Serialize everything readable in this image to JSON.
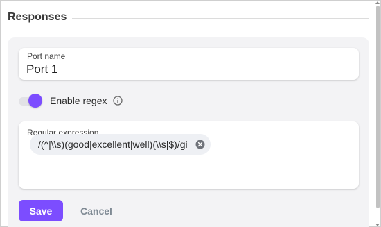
{
  "section": {
    "title": "Responses"
  },
  "port_name": {
    "label": "Port name",
    "value": "Port 1"
  },
  "regex_toggle": {
    "label": "Enable regex",
    "enabled": true,
    "info_icon": "info-icon"
  },
  "regular_expression": {
    "label": "Regular expression",
    "chips": [
      {
        "value": "/(^|\\\\s)(good|excellent|well)(\\\\s|$)/gi",
        "remove_icon": "close-circle-icon"
      }
    ]
  },
  "actions": {
    "save_label": "Save",
    "cancel_label": "Cancel"
  },
  "colors": {
    "accent": "#7c4dff",
    "panel_bg": "#f3f3f5",
    "chip_bg": "#eef0f4",
    "cancel_text": "#7f8a94"
  }
}
